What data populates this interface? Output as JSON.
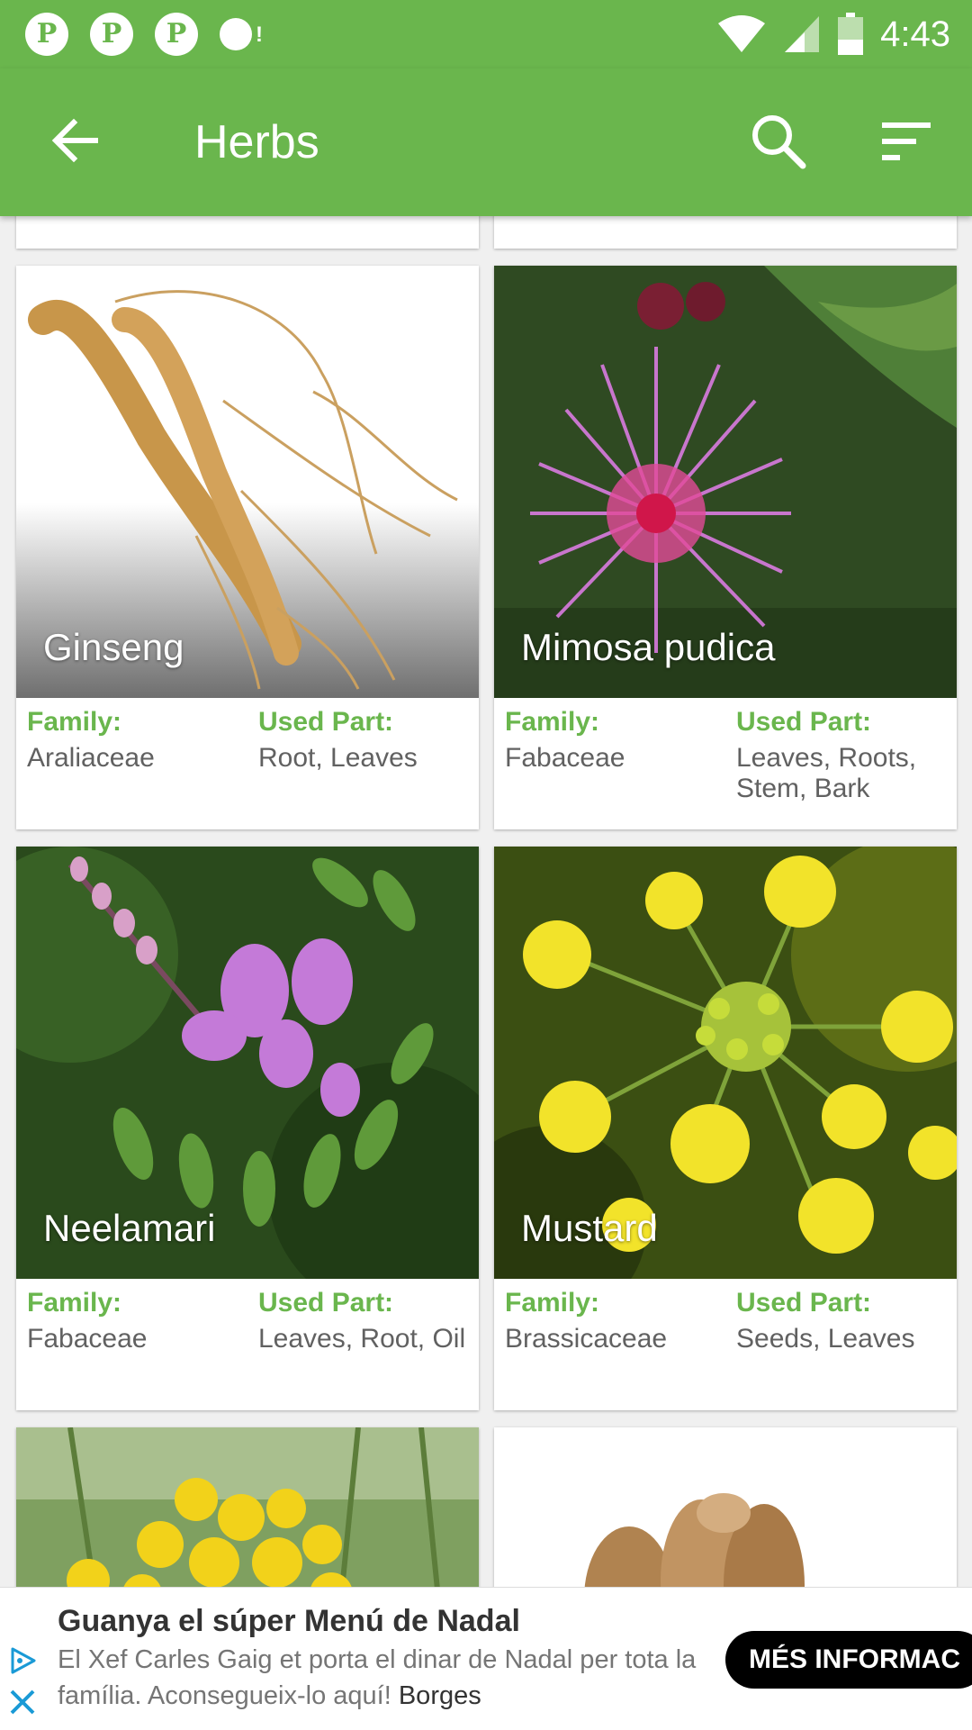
{
  "status_bar": {
    "time": "4:43",
    "notification_icons": [
      "pinterest-icon",
      "pinterest-icon",
      "pinterest-icon",
      "chat-icon"
    ],
    "system_icons": [
      "wifi-icon",
      "signal-icon",
      "battery-icon"
    ]
  },
  "app_bar": {
    "title": "Herbs",
    "icons": {
      "back": "back-arrow-icon",
      "search": "search-icon",
      "sort": "sort-icon"
    }
  },
  "labels": {
    "family": "Family:",
    "used_part": "Used Part:"
  },
  "herbs": [
    {
      "name": "Ginseng",
      "family": "Araliaceae",
      "used_part": "Root, Leaves"
    },
    {
      "name": "Mimosa pudica",
      "family": "Fabaceae",
      "used_part": "Leaves, Roots, Stem, Bark"
    },
    {
      "name": "Neelamari",
      "family": "Fabaceae",
      "used_part": "Leaves, Root, Oil"
    },
    {
      "name": "Mustard",
      "family": "Brassicaceae",
      "used_part": "Seeds, Leaves"
    }
  ],
  "ad": {
    "title": "Guanya el súper Menú de Nadal",
    "body": "El Xef Carles Gaig et porta el dinar de Nadal per tota la família. Aconsegueix-lo aquí!",
    "brand": "Borges",
    "cta": "MÉS INFORMAC"
  },
  "colors": {
    "primary": "#6ab64d",
    "label": "#6ab64d",
    "value_text": "#616161"
  }
}
